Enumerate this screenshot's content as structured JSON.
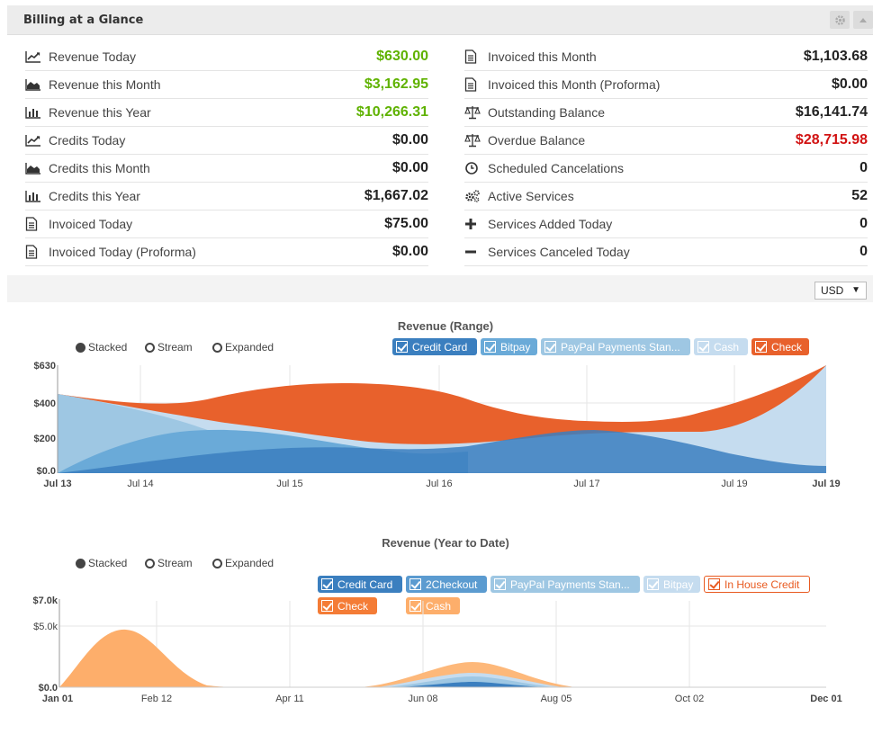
{
  "panel": {
    "title": "Billing at a Glance"
  },
  "stats_left": [
    {
      "icon": "line-chart-icon",
      "label": "Revenue Today",
      "value": "$630.00",
      "tone": "green"
    },
    {
      "icon": "area-chart-icon",
      "label": "Revenue this Month",
      "value": "$3,162.95",
      "tone": "green"
    },
    {
      "icon": "bar-chart-icon",
      "label": "Revenue this Year",
      "value": "$10,266.31",
      "tone": "green"
    },
    {
      "icon": "line-chart-icon",
      "label": "Credits Today",
      "value": "$0.00",
      "tone": ""
    },
    {
      "icon": "area-chart-icon",
      "label": "Credits this Month",
      "value": "$0.00",
      "tone": ""
    },
    {
      "icon": "bar-chart-icon",
      "label": "Credits this Year",
      "value": "$1,667.02",
      "tone": ""
    },
    {
      "icon": "document-icon",
      "label": "Invoiced Today",
      "value": "$75.00",
      "tone": ""
    },
    {
      "icon": "document-icon",
      "label": "Invoiced Today (Proforma)",
      "value": "$0.00",
      "tone": ""
    }
  ],
  "stats_right": [
    {
      "icon": "document-icon",
      "label": "Invoiced this Month",
      "value": "$1,103.68",
      "tone": ""
    },
    {
      "icon": "document-icon",
      "label": "Invoiced this Month (Proforma)",
      "value": "$0.00",
      "tone": ""
    },
    {
      "icon": "scales-icon",
      "label": "Outstanding Balance",
      "value": "$16,141.74",
      "tone": ""
    },
    {
      "icon": "scales-icon",
      "label": "Overdue Balance",
      "value": "$28,715.98",
      "tone": "red"
    },
    {
      "icon": "clock-icon",
      "label": "Scheduled Cancelations",
      "value": "0",
      "tone": ""
    },
    {
      "icon": "gears-icon",
      "label": "Active Services",
      "value": "52",
      "tone": ""
    },
    {
      "icon": "plus-icon",
      "label": "Services Added Today",
      "value": "0",
      "tone": ""
    },
    {
      "icon": "minus-icon",
      "label": "Services Canceled Today",
      "value": "0",
      "tone": ""
    }
  ],
  "currency": {
    "selected": "USD"
  },
  "controls": {
    "stacked": "Stacked",
    "stream": "Stream",
    "expanded": "Expanded"
  },
  "colors": {
    "credit_card": "#3b7fbf",
    "bitpay": "#6aaad8",
    "paypal": "#9ec7e3",
    "cash_range": "#c5dcef",
    "check": "#e8612c",
    "ytd_orange": "#fdae6b",
    "ytd_light_orange": "#fdc891"
  },
  "chart_data": [
    {
      "type": "area",
      "title": "Revenue (Range)",
      "x_ticks": [
        "Jul 13",
        "Jul 14",
        "Jul 15",
        "Jul 16",
        "Jul 17",
        "Jul 19",
        "Jul 19"
      ],
      "y_ticks": [
        "$0.0",
        "$200",
        "$400",
        "$630"
      ],
      "ylim": [
        0,
        630
      ],
      "legend": [
        "Credit Card",
        "Bitpay",
        "PayPal Payments Stan...",
        "Cash",
        "Check"
      ],
      "series": [
        {
          "name": "Credit Card",
          "values": [
            0,
            60,
            150,
            140,
            230,
            150,
            50
          ]
        },
        {
          "name": "Bitpay",
          "values": [
            0,
            160,
            220,
            80,
            0,
            0,
            0
          ]
        },
        {
          "name": "PayPal Payments Stan...",
          "values": [
            450,
            100,
            0,
            0,
            0,
            0,
            0
          ]
        },
        {
          "name": "Cash",
          "values": [
            0,
            0,
            0,
            0,
            0,
            180,
            580
          ]
        },
        {
          "name": "Check",
          "values": [
            0,
            50,
            280,
            290,
            120,
            100,
            0
          ]
        }
      ]
    },
    {
      "type": "area",
      "title": "Revenue (Year to Date)",
      "x_ticks": [
        "Jan 01",
        "Feb 12",
        "Apr 11",
        "Jun 08",
        "Aug 05",
        "Oct 02",
        "Dec 01"
      ],
      "y_ticks": [
        "$0.0",
        "$5.0k",
        "$7.0k"
      ],
      "ylim": [
        0,
        7000
      ],
      "legend": [
        "Credit Card",
        "2Checkout",
        "PayPal Payments Stan...",
        "Bitpay",
        "In House Credit",
        "Check",
        "Cash"
      ],
      "series": [
        {
          "name": "Credit Card",
          "values": [
            0,
            0,
            0,
            0,
            400,
            0,
            0
          ]
        },
        {
          "name": "PayPal Payments Stan...",
          "values": [
            0,
            0,
            0,
            0,
            500,
            0,
            0
          ]
        },
        {
          "name": "Cash",
          "values": [
            0,
            4500,
            0,
            0,
            1100,
            0,
            0
          ]
        }
      ]
    }
  ]
}
